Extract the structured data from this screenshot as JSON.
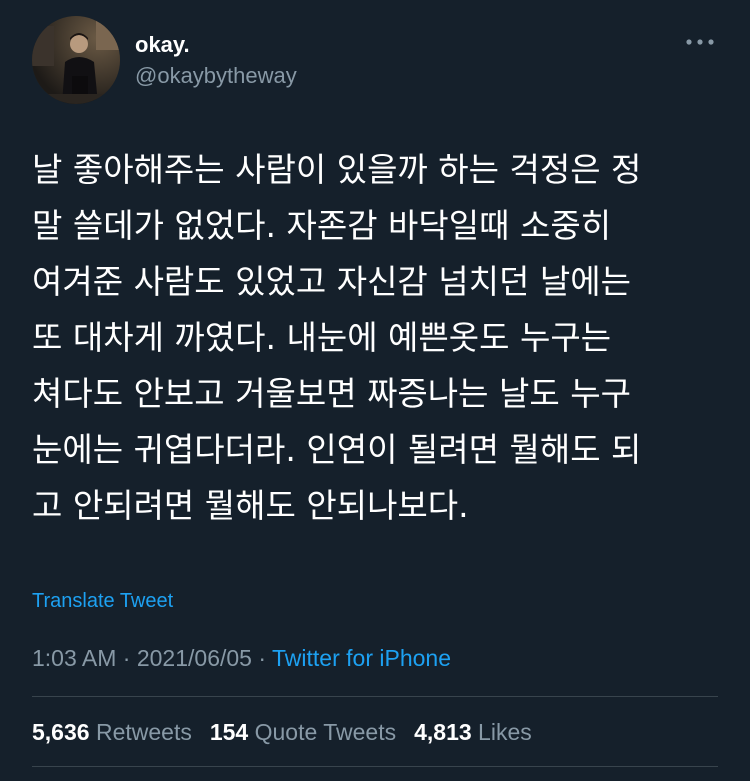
{
  "author": {
    "display_name": "okay.",
    "handle": "@okaybytheway",
    "avatar_icon": "profile-photo"
  },
  "tweet": {
    "text": "날 좋아해주는 사람이 있을까 하는 걱정은 정\n말 쓸데가 없었다. 자존감 바닥일때 소중히\n여겨준 사람도 있었고 자신감 넘치던 날에는\n또 대차게 까였다. 내눈에 예쁜옷도 누구는\n쳐다도 안보고 거울보면 짜증나는 날도 누구\n눈에는 귀엽다더라. 인연이 될려면 뭘해도 되\n고 안되려면 뭘해도 안되나보다.",
    "translate_label": "Translate Tweet"
  },
  "meta": {
    "time": "1:03 AM",
    "separator": "·",
    "date": "2021/06/05",
    "source": "Twitter for iPhone"
  },
  "stats": {
    "retweets_count": "5,636",
    "retweets_label": "Retweets",
    "quote_count": "154",
    "quote_label": "Quote Tweets",
    "likes_count": "4,813",
    "likes_label": "Likes"
  },
  "colors": {
    "background": "#15202b",
    "accent": "#1da1f2",
    "secondary_text": "#8899a6",
    "divider": "#38444d"
  },
  "icons": {
    "more": "more-horizontal-icon"
  }
}
